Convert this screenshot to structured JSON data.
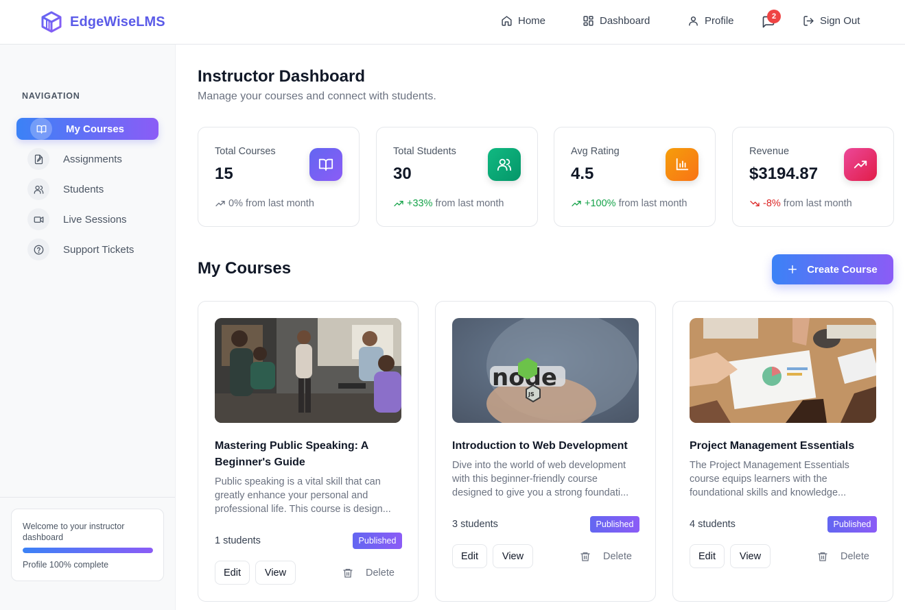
{
  "header": {
    "brand": "EdgeWiseLMS",
    "nav": {
      "home": "Home",
      "dashboard": "Dashboard",
      "profile": "Profile",
      "messages_badge": "2",
      "signout": "Sign Out"
    }
  },
  "sidebar": {
    "heading": "NAVIGATION",
    "items": [
      {
        "label": "My Courses",
        "icon": "book-open-icon",
        "active": true
      },
      {
        "label": "Assignments",
        "icon": "file-edit-icon"
      },
      {
        "label": "Students",
        "icon": "users-icon"
      },
      {
        "label": "Live Sessions",
        "icon": "video-icon"
      },
      {
        "label": "Support Tickets",
        "icon": "help-circle-icon"
      }
    ],
    "welcome": {
      "text": "Welcome to your instructor dashboard",
      "progress_percent": 100,
      "progress_text": "Profile 100% complete"
    }
  },
  "main": {
    "title": "Instructor Dashboard",
    "subtitle": "Manage your courses and connect with students.",
    "stats": [
      {
        "label": "Total Courses",
        "value": "15",
        "trend": "0%",
        "trend_suffix": "from last month",
        "direction": "neutral",
        "color": "#8b5cf6",
        "icon": "book-open-icon"
      },
      {
        "label": "Total Students",
        "value": "30",
        "trend": "+33%",
        "trend_suffix": "from last month",
        "direction": "up",
        "color": "#10b981",
        "icon": "users-icon"
      },
      {
        "label": "Avg Rating",
        "value": "4.5",
        "trend": "+100%",
        "trend_suffix": "from last month",
        "direction": "up",
        "color": "#f59e0b",
        "icon": "bar-chart-icon"
      },
      {
        "label": "Revenue",
        "value": "$3194.87",
        "trend": "-8%",
        "trend_suffix": "from last month",
        "direction": "down",
        "color": "#ec4899",
        "icon": "trending-up-icon"
      }
    ],
    "courses_title": "My Courses",
    "create_label": "Create Course",
    "courses": [
      {
        "title": "Mastering Public Speaking: A Beginner's Guide",
        "description": "Public speaking is a vital skill that can greatly enhance your personal and professional life. This course is design...",
        "students": "1 students",
        "status": "Published",
        "edit": "Edit",
        "view": "View",
        "delete": "Delete"
      },
      {
        "title": "Introduction to Web Development",
        "description": "Dive into the world of web development with this beginner-friendly course designed to give you a strong foundati...",
        "students": "3 students",
        "status": "Published",
        "edit": "Edit",
        "view": "View",
        "delete": "Delete"
      },
      {
        "title": "Project Management Essentials",
        "description": "The Project Management Essentials course equips learners with the foundational skills and knowledge...",
        "students": "4 students",
        "status": "Published",
        "edit": "Edit",
        "view": "View",
        "delete": "Delete"
      }
    ]
  }
}
